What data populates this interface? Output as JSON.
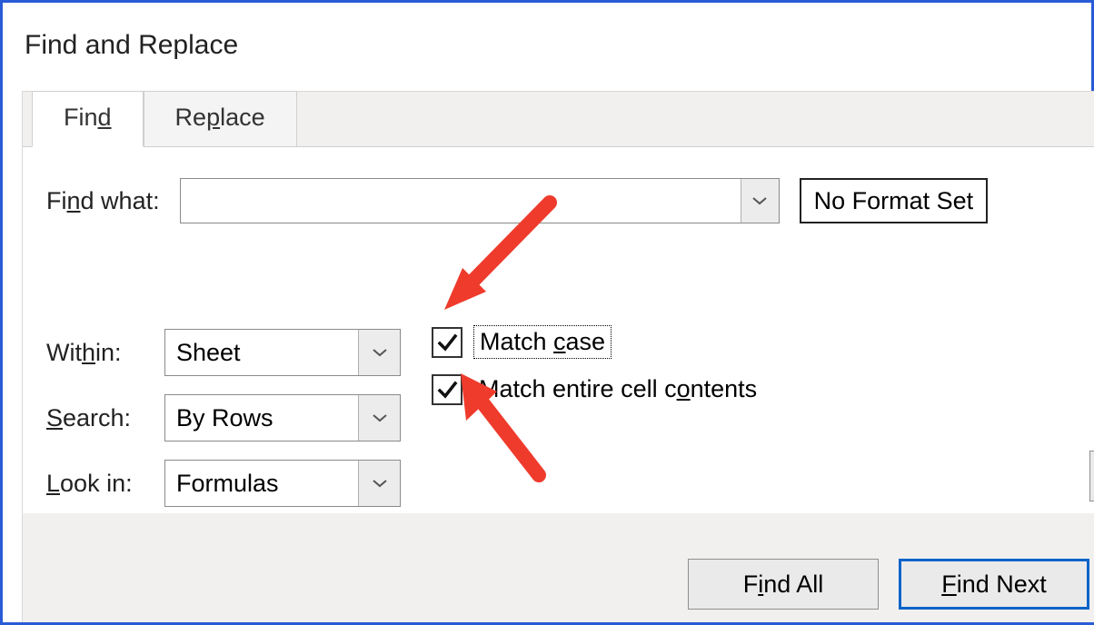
{
  "window": {
    "title": "Find and Replace"
  },
  "tabs": {
    "find": "Find",
    "replace": "Replace",
    "active": "find"
  },
  "find": {
    "find_what_label": "Find what:",
    "find_what_value": "",
    "format_button": "No Format Set"
  },
  "options": {
    "within_label": "Within:",
    "within_value": "Sheet",
    "search_label": "Search:",
    "search_value": "By Rows",
    "lookin_label": "Look in:",
    "lookin_value": "Formulas"
  },
  "checks": {
    "match_case_label_pre": "Match ",
    "match_case_ul": "c",
    "match_case_label_post": "ase",
    "match_case_checked": true,
    "match_entire_label_pre": "Match entire cell c",
    "match_entire_ul": "o",
    "match_entire_label_post": "ntents",
    "match_entire_checked": true
  },
  "buttons": {
    "find_all_pre": "F",
    "find_all_ul": "i",
    "find_all_post": "nd All",
    "find_next_pre": "",
    "find_next_ul": "F",
    "find_next_post": "ind Next"
  },
  "accent_color": "#2a5bd7",
  "annotation_color": "#ef3b2c"
}
